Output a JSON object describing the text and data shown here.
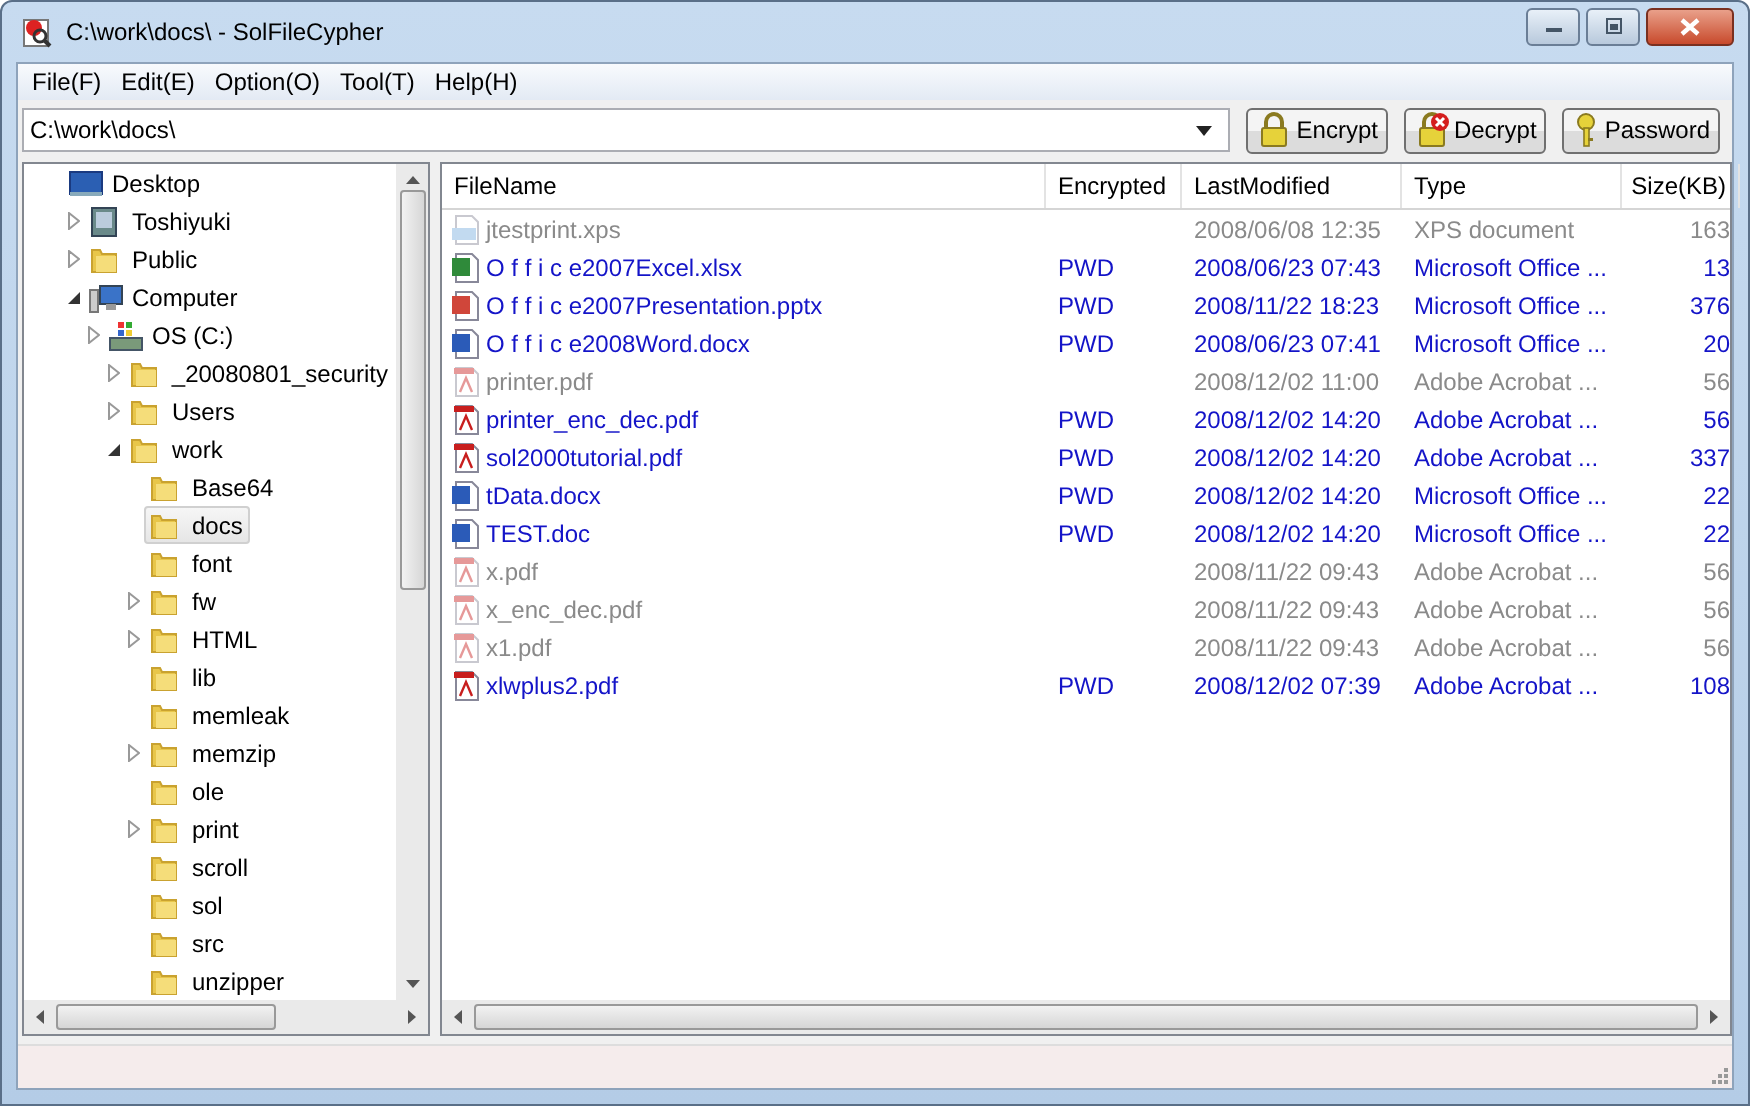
{
  "window": {
    "title": "C:\\work\\docs\\ - SolFileCypher"
  },
  "menu": [
    "File(F)",
    "Edit(E)",
    "Option(O)",
    "Tool(T)",
    "Help(H)"
  ],
  "address": {
    "value": "C:\\work\\docs\\"
  },
  "buttons": [
    {
      "label": "Encrypt",
      "kind": "encrypt"
    },
    {
      "label": "Decrypt",
      "kind": "decrypt"
    },
    {
      "label": "Password",
      "kind": "password"
    }
  ],
  "tree": [
    {
      "label": "Desktop",
      "kind": "desktop",
      "selected": false,
      "children": [
        {
          "label": "Toshiyuki",
          "kind": "user",
          "selected": false,
          "expanded": false
        },
        {
          "label": "Public",
          "kind": "folder",
          "selected": false,
          "expanded": false
        },
        {
          "label": "Computer",
          "kind": "computer",
          "selected": false,
          "expanded": true,
          "children": [
            {
              "label": "OS (C:)",
              "kind": "drive",
              "selected": false,
              "expanded": false,
              "children": [
                {
                  "label": "_20080801_security",
                  "kind": "folder",
                  "selected": false,
                  "expanded": false
                },
                {
                  "label": "Users",
                  "kind": "folder",
                  "selected": false,
                  "expanded": false
                },
                {
                  "label": "work",
                  "kind": "folder",
                  "selected": false,
                  "expanded": true,
                  "children": [
                    {
                      "label": "Base64",
                      "kind": "folder",
                      "selected": false
                    },
                    {
                      "label": "docs",
                      "kind": "folder",
                      "selected": true
                    },
                    {
                      "label": "font",
                      "kind": "folder",
                      "selected": false
                    },
                    {
                      "label": "fw",
                      "kind": "folder",
                      "selected": false,
                      "expanded": false
                    },
                    {
                      "label": "HTML",
                      "kind": "folder",
                      "selected": false,
                      "expanded": false
                    },
                    {
                      "label": "lib",
                      "kind": "folder",
                      "selected": false
                    },
                    {
                      "label": "memleak",
                      "kind": "folder",
                      "selected": false
                    },
                    {
                      "label": "memzip",
                      "kind": "folder",
                      "selected": false,
                      "expanded": false
                    },
                    {
                      "label": "ole",
                      "kind": "folder",
                      "selected": false
                    },
                    {
                      "label": "print",
                      "kind": "folder",
                      "selected": false,
                      "expanded": false
                    },
                    {
                      "label": "scroll",
                      "kind": "folder",
                      "selected": false
                    },
                    {
                      "label": "sol",
                      "kind": "folder",
                      "selected": false
                    },
                    {
                      "label": "src",
                      "kind": "folder",
                      "selected": false
                    },
                    {
                      "label": "unzipper",
                      "kind": "folder",
                      "selected": false
                    }
                  ]
                }
              ]
            }
          ]
        }
      ]
    }
  ],
  "table": {
    "columns": [
      "FileName",
      "Encrypted",
      "LastModified",
      "Type",
      "Size(KB)"
    ],
    "rows": [
      {
        "name": "jtestprint.xps",
        "kind": "xps",
        "encrypted": false,
        "modified": "2008/06/08 12:35",
        "type": "XPS document",
        "size": "163"
      },
      {
        "name": "O f f i c e2007Excel.xlsx",
        "kind": "excel",
        "encrypted": true,
        "encrypted_text": "PWD",
        "modified": "2008/06/23 07:43",
        "type": "Microsoft Office ...",
        "size": "13"
      },
      {
        "name": "O f f i c e2007Presentation.pptx",
        "kind": "powerpoint",
        "encrypted": true,
        "encrypted_text": "PWD",
        "modified": "2008/11/22 18:23",
        "type": "Microsoft Office ...",
        "size": "376"
      },
      {
        "name": "O f f i c e2008Word.docx",
        "kind": "word",
        "encrypted": true,
        "encrypted_text": "PWD",
        "modified": "2008/06/23 07:41",
        "type": "Microsoft Office ...",
        "size": "20"
      },
      {
        "name": "printer.pdf",
        "kind": "pdf",
        "encrypted": false,
        "modified": "2008/12/02 11:00",
        "type": "Adobe Acrobat ...",
        "size": "56"
      },
      {
        "name": "printer_enc_dec.pdf",
        "kind": "pdf",
        "encrypted": true,
        "encrypted_text": "PWD",
        "modified": "2008/12/02 14:20",
        "type": "Adobe Acrobat ...",
        "size": "56"
      },
      {
        "name": "sol2000tutorial.pdf",
        "kind": "pdf",
        "encrypted": true,
        "encrypted_text": "PWD",
        "modified": "2008/12/02 14:20",
        "type": "Adobe Acrobat ...",
        "size": "337"
      },
      {
        "name": "tData.docx",
        "kind": "word",
        "encrypted": true,
        "encrypted_text": "PWD",
        "modified": "2008/12/02 14:20",
        "type": "Microsoft Office ...",
        "size": "22"
      },
      {
        "name": "TEST.doc",
        "kind": "word",
        "encrypted": true,
        "encrypted_text": "PWD",
        "modified": "2008/12/02 14:20",
        "type": "Microsoft Office ...",
        "size": "22"
      },
      {
        "name": "x.pdf",
        "kind": "pdf",
        "encrypted": false,
        "modified": "2008/11/22 09:43",
        "type": "Adobe Acrobat ...",
        "size": "56"
      },
      {
        "name": "x_enc_dec.pdf",
        "kind": "pdf",
        "encrypted": false,
        "modified": "2008/11/22 09:43",
        "type": "Adobe Acrobat ...",
        "size": "56"
      },
      {
        "name": "x1.pdf",
        "kind": "pdf",
        "encrypted": false,
        "modified": "2008/11/22 09:43",
        "type": "Adobe Acrobat ...",
        "size": "56"
      },
      {
        "name": "xlwplus2.pdf",
        "kind": "pdf",
        "encrypted": true,
        "encrypted_text": "PWD",
        "modified": "2008/12/02 07:39",
        "type": "Adobe Acrobat ...",
        "size": "108"
      }
    ]
  }
}
